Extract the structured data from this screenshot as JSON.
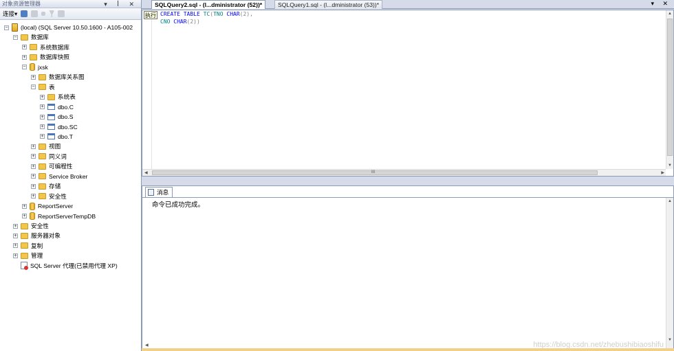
{
  "object_explorer": {
    "title": "对象资源管理器",
    "controls": "▾ ꟾ ✕",
    "toolbar": {
      "connect_label": "连接▾"
    },
    "tree": [
      {
        "label": "(local) (SQL Server 10.50.1600 - A105-002",
        "icon": "server-icon",
        "exp": "⊟",
        "lvl": 0
      },
      {
        "label": "数据库",
        "icon": "folder-icon",
        "exp": "⊟",
        "lvl": 1
      },
      {
        "label": "系统数据库",
        "icon": "folder-icon",
        "exp": "⊞",
        "lvl": 2
      },
      {
        "label": "数据库快照",
        "icon": "folder-icon",
        "exp": "⊞",
        "lvl": 2
      },
      {
        "label": "jxsk",
        "icon": "database-icon",
        "exp": "⊟",
        "lvl": 2
      },
      {
        "label": "数据库关系图",
        "icon": "folder-icon",
        "exp": "⊞",
        "lvl": 3
      },
      {
        "label": "表",
        "icon": "folder-icon",
        "exp": "⊟",
        "lvl": 3
      },
      {
        "label": "系统表",
        "icon": "folder-icon",
        "exp": "⊞",
        "lvl": 4
      },
      {
        "label": "dbo.C",
        "icon": "table-icon",
        "exp": "⊞",
        "lvl": 4
      },
      {
        "label": "dbo.S",
        "icon": "table-icon",
        "exp": "⊞",
        "lvl": 4
      },
      {
        "label": "dbo.SC",
        "icon": "table-icon",
        "exp": "⊞",
        "lvl": 4
      },
      {
        "label": "dbo.T",
        "icon": "table-icon",
        "exp": "⊞",
        "lvl": 4
      },
      {
        "label": "视图",
        "icon": "folder-icon",
        "exp": "⊞",
        "lvl": 3
      },
      {
        "label": "同义词",
        "icon": "folder-icon",
        "exp": "⊞",
        "lvl": 3
      },
      {
        "label": "可编程性",
        "icon": "folder-icon",
        "exp": "⊞",
        "lvl": 3
      },
      {
        "label": "Service Broker",
        "icon": "folder-icon",
        "exp": "⊞",
        "lvl": 3
      },
      {
        "label": "存储",
        "icon": "folder-icon",
        "exp": "⊞",
        "lvl": 3
      },
      {
        "label": "安全性",
        "icon": "folder-icon",
        "exp": "⊞",
        "lvl": 3
      },
      {
        "label": "ReportServer",
        "icon": "database-icon",
        "exp": "⊞",
        "lvl": 2
      },
      {
        "label": "ReportServerTempDB",
        "icon": "database-icon",
        "exp": "⊞",
        "lvl": 2
      },
      {
        "label": "安全性",
        "icon": "folder-icon",
        "exp": "⊞",
        "lvl": 1
      },
      {
        "label": "服务器对象",
        "icon": "folder-icon",
        "exp": "⊞",
        "lvl": 1
      },
      {
        "label": "复制",
        "icon": "folder-icon",
        "exp": "⊞",
        "lvl": 1
      },
      {
        "label": "管理",
        "icon": "folder-icon",
        "exp": "⊞",
        "lvl": 1
      },
      {
        "label": "SQL Server 代理(已禁用代理 XP)",
        "icon": "sql-agent-icon",
        "exp": "",
        "lvl": 1
      }
    ]
  },
  "tabs": {
    "active": "SQLQuery2.sql - (l...dministrator (52))*",
    "inactive": "SQLQuery1.sql - (l...dministrator (53))*",
    "controls": "▾ ✕"
  },
  "editor": {
    "tooltip": "执行",
    "line1": {
      "kw1": "CREATE TABLE",
      "id": "TC",
      "p1": "(",
      "col": "TNO",
      "kw2": "CHAR",
      "p2": "(2),",
      "nums": ""
    },
    "line2": {
      "col": "CNO",
      "kw2": "CHAR",
      "p2": "(2))"
    },
    "hscroll_marker": "III"
  },
  "results": {
    "tab_label": "消息",
    "message": "命令已成功完成。"
  },
  "watermark": "https://blog.csdn.net/zhebushibiaoshifu"
}
